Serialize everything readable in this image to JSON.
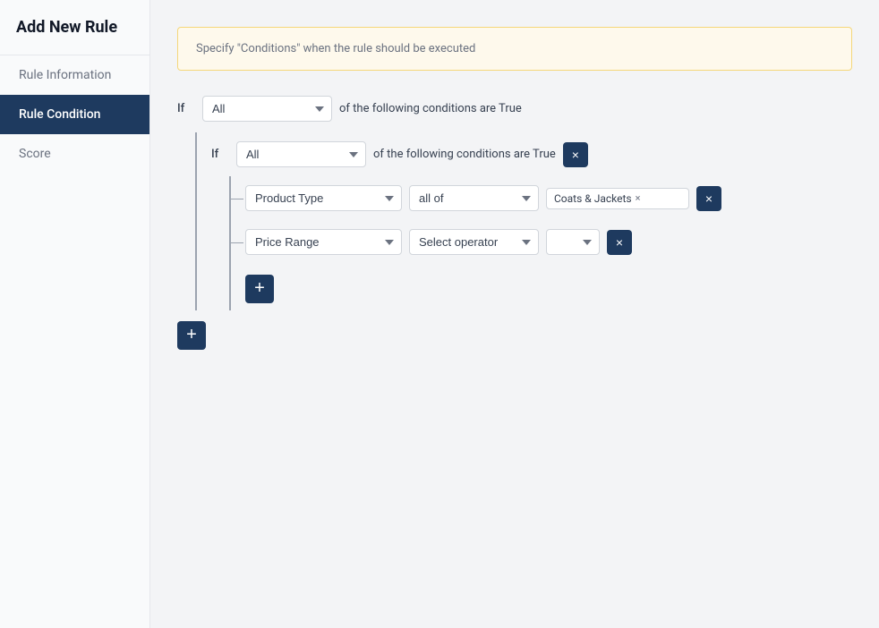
{
  "page": {
    "title": "Add New Rule"
  },
  "sidebar": {
    "items": [
      {
        "id": "rule-information",
        "label": "Rule Information",
        "active": false
      },
      {
        "id": "rule-condition",
        "label": "Rule Condition",
        "active": true
      },
      {
        "id": "score",
        "label": "Score",
        "active": false
      }
    ]
  },
  "main": {
    "info_text": "Specify \"Conditions\" when the rule should be executed",
    "outer_if": {
      "label": "If",
      "select_value": "All",
      "conditions_text": "of the following conditions are True"
    },
    "nested_if": {
      "label": "If",
      "select_value": "All",
      "conditions_text": "of the following conditions are True"
    },
    "conditions": [
      {
        "field": "Product Type",
        "operator": "all of",
        "tags": [
          "Coats & Jackets"
        ],
        "has_mini_select": false
      },
      {
        "field": "Price Range",
        "operator": "Select operator",
        "tags": [],
        "has_mini_select": true
      }
    ],
    "buttons": {
      "remove_label": "×",
      "add_label": "+",
      "nested_add_label": "+"
    }
  }
}
